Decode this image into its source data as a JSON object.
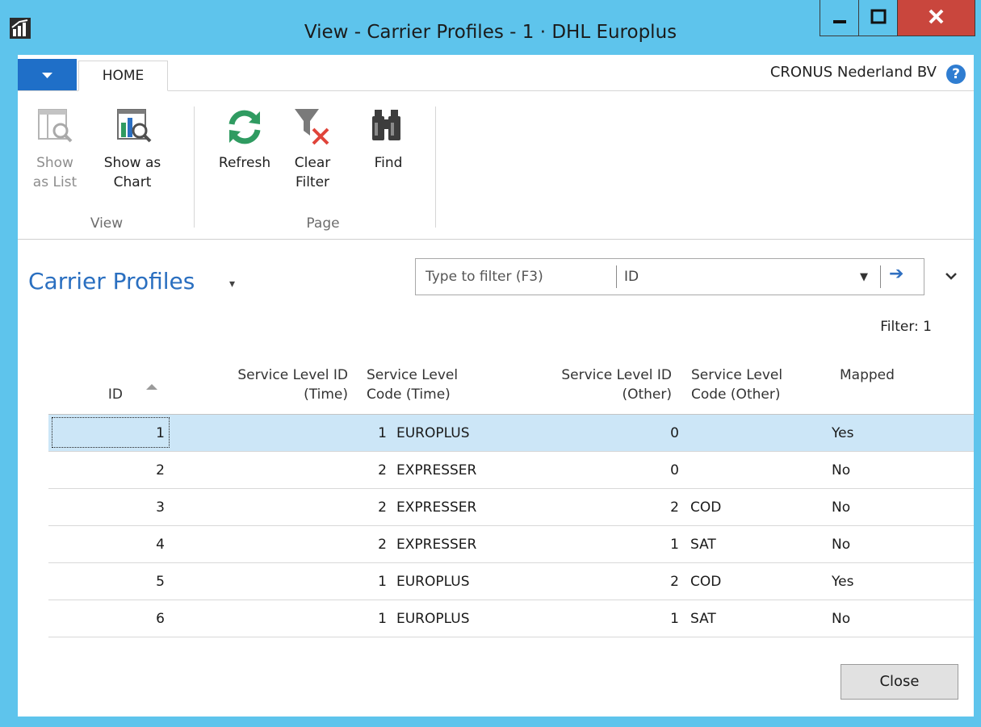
{
  "window": {
    "title": "View - Carrier Profiles - 1 · DHL Europlus"
  },
  "ribbon": {
    "tab_home": "HOME",
    "company": "CRONUS Nederland BV",
    "buttons": {
      "show_as_list": "Show\nas List",
      "show_as_chart": "Show as\nChart",
      "refresh": "Refresh",
      "clear_filter": "Clear\nFilter",
      "find": "Find"
    },
    "groups": {
      "view": "View",
      "page": "Page"
    }
  },
  "page": {
    "title": "Carrier Profiles",
    "filter_placeholder": "Type to filter (F3)",
    "filter_field": "ID",
    "filter_count": "Filter: 1"
  },
  "table": {
    "headers": {
      "id": "ID",
      "sl_id_time": "Service Level ID\n(Time)",
      "sl_code_time": "Service Level\nCode (Time)",
      "sl_id_other": "Service Level ID\n(Other)",
      "sl_code_other": "Service Level\nCode (Other)",
      "mapped": "Mapped"
    },
    "rows": [
      {
        "id": "1",
        "sl_id_time": "1",
        "sl_code_time": "EUROPLUS",
        "sl_id_other": "0",
        "sl_code_other": "",
        "mapped": "Yes"
      },
      {
        "id": "2",
        "sl_id_time": "2",
        "sl_code_time": "EXPRESSER",
        "sl_id_other": "0",
        "sl_code_other": "",
        "mapped": "No"
      },
      {
        "id": "3",
        "sl_id_time": "2",
        "sl_code_time": "EXPRESSER",
        "sl_id_other": "2",
        "sl_code_other": "COD",
        "mapped": "No"
      },
      {
        "id": "4",
        "sl_id_time": "2",
        "sl_code_time": "EXPRESSER",
        "sl_id_other": "1",
        "sl_code_other": "SAT",
        "mapped": "No"
      },
      {
        "id": "5",
        "sl_id_time": "1",
        "sl_code_time": "EUROPLUS",
        "sl_id_other": "2",
        "sl_code_other": "COD",
        "mapped": "Yes"
      },
      {
        "id": "6",
        "sl_id_time": "1",
        "sl_code_time": "EUROPLUS",
        "sl_id_other": "1",
        "sl_code_other": "SAT",
        "mapped": "No"
      }
    ],
    "selected_row": 0
  },
  "footer": {
    "close_label": "Close"
  },
  "colors": {
    "titlebar": "#5ec4ec",
    "accent": "#2a6fc0",
    "close_red": "#c9463d",
    "selection": "#cce6f7",
    "refresh_green": "#2f9b61",
    "clear_red": "#e0443a"
  },
  "icons": [
    "app-icon",
    "show-as-list-icon",
    "show-as-chart-icon",
    "refresh-icon",
    "clear-filter-icon",
    "find-icon",
    "help-icon",
    "dropdown-icon",
    "arrow-right-icon",
    "chevron-down-icon",
    "sort-ascending-icon"
  ]
}
